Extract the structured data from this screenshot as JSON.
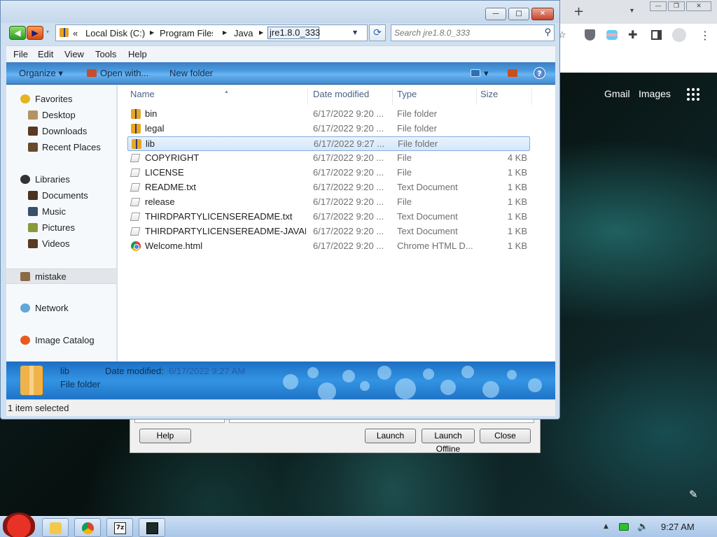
{
  "explorer": {
    "window_buttons": {
      "minimize": "—",
      "maximize": "□",
      "close": "✕"
    },
    "address": {
      "overflow": "«",
      "crumbs": [
        "Local Disk (C:)",
        "Program Files",
        "Java"
      ],
      "current": "jre1.8.0_333"
    },
    "search": {
      "placeholder": "Search jre1.8.0_333"
    },
    "menu": [
      "File",
      "Edit",
      "View",
      "Tools",
      "Help"
    ],
    "commands": {
      "organize": "Organize ▾",
      "open_with": "Open with...",
      "new_folder": "New folder"
    },
    "nav_pane": {
      "favorites": "Favorites",
      "favorite_items": [
        "Desktop",
        "Downloads",
        "Recent Places"
      ],
      "libraries": "Libraries",
      "library_items": [
        "Documents",
        "Music",
        "Pictures",
        "Videos"
      ],
      "mistake": "mistake",
      "network": "Network",
      "image_catalog": "Image Catalog"
    },
    "columns": {
      "name": "Name",
      "date": "Date modified",
      "type": "Type",
      "size": "Size"
    },
    "files": [
      {
        "name": "bin",
        "date": "6/17/2022 9:20 ...",
        "type": "File folder",
        "size": "",
        "icon": "folder"
      },
      {
        "name": "legal",
        "date": "6/17/2022 9:20 ...",
        "type": "File folder",
        "size": "",
        "icon": "folder"
      },
      {
        "name": "lib",
        "date": "6/17/2022 9:27 ...",
        "type": "File folder",
        "size": "",
        "icon": "folder"
      },
      {
        "name": "COPYRIGHT",
        "date": "6/17/2022 9:20 ...",
        "type": "File",
        "size": "4 KB",
        "icon": "file"
      },
      {
        "name": "LICENSE",
        "date": "6/17/2022 9:20 ...",
        "type": "File",
        "size": "1 KB",
        "icon": "file"
      },
      {
        "name": "README.txt",
        "date": "6/17/2022 9:20 ...",
        "type": "Text Document",
        "size": "1 KB",
        "icon": "file"
      },
      {
        "name": "release",
        "date": "6/17/2022 9:20 ...",
        "type": "File",
        "size": "1 KB",
        "icon": "file"
      },
      {
        "name": "THIRDPARTYLICENSEREADME.txt",
        "date": "6/17/2022 9:20 ...",
        "type": "Text Document",
        "size": "1 KB",
        "icon": "file"
      },
      {
        "name": "THIRDPARTYLICENSEREADME-JAVAF...",
        "date": "6/17/2022 9:20 ...",
        "type": "Text Document",
        "size": "1 KB",
        "icon": "file"
      },
      {
        "name": "Welcome.html",
        "date": "6/17/2022 9:20 ...",
        "type": "Chrome HTML D...",
        "size": "1 KB",
        "icon": "chrome"
      }
    ],
    "selected_index": 2,
    "details": {
      "name": "lib",
      "date_label": "Date modified:",
      "date_value": "6/17/2022 9:27 AM",
      "type": "File folder"
    },
    "status": "1 item selected"
  },
  "launcher": {
    "help": "Help",
    "launch": "Launch",
    "launch_offline": "Launch Offline",
    "close": "Close"
  },
  "browser": {
    "gmail": "Gmail",
    "images": "Images",
    "new_tab": "+"
  },
  "taskbar": {
    "time": "9:27 AM"
  },
  "colors": {
    "selection": "#d3e6fb",
    "command_bar": "#4b9be0",
    "details_pane": "#2a84d6"
  }
}
